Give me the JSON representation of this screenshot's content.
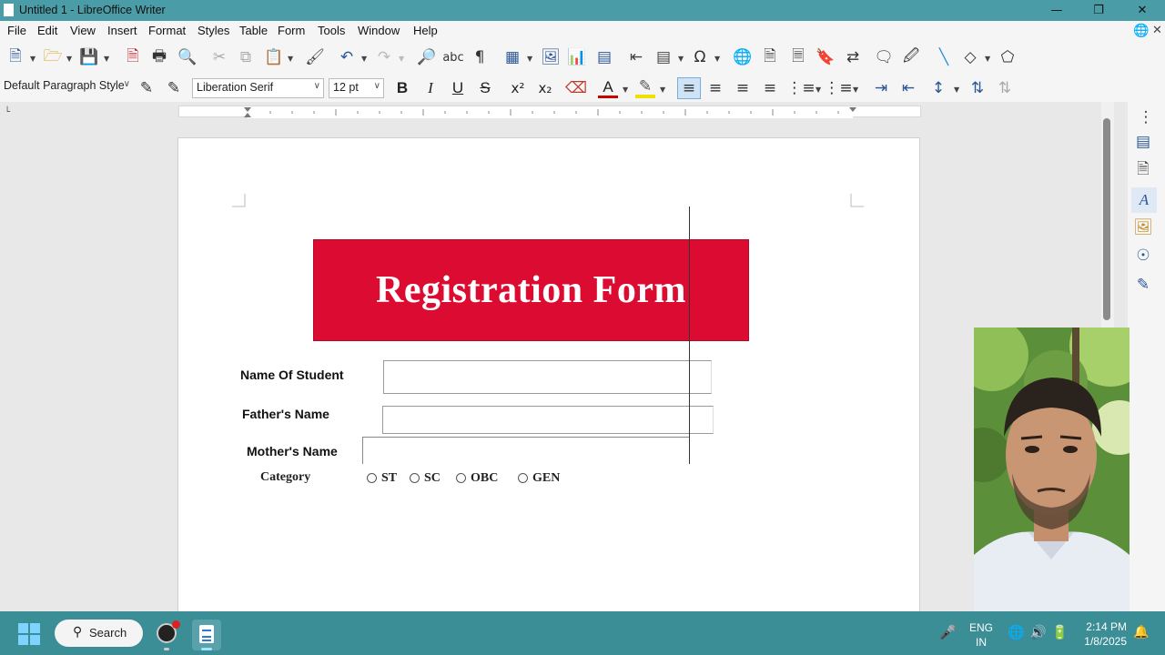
{
  "window": {
    "title": "Untitled 1 - LibreOffice Writer"
  },
  "menubar": {
    "items": [
      "File",
      "Edit",
      "View",
      "Insert",
      "Format",
      "Styles",
      "Table",
      "Form",
      "Tools",
      "Window",
      "Help"
    ]
  },
  "formatting": {
    "paragraph_style": "Default Paragraph Style",
    "font_name": "Liberation Serif",
    "font_size": "12 pt"
  },
  "document": {
    "banner_title": "Registration Form",
    "fields": [
      {
        "label": "Name Of Student"
      },
      {
        "label": "Father's Name"
      },
      {
        "label": "Mother's Name"
      }
    ],
    "category_label": "Category",
    "category_options": [
      "ST",
      "SC",
      "OBC",
      "GEN"
    ]
  },
  "colors": {
    "banner": "#dc0b32",
    "titlebar": "#4a9ca6",
    "taskbar": "#3b8d96"
  },
  "taskbar": {
    "search_label": "Search",
    "language_top": "ENG",
    "language_bottom": "IN",
    "time": "2:14 PM",
    "date": "1/8/2025"
  }
}
